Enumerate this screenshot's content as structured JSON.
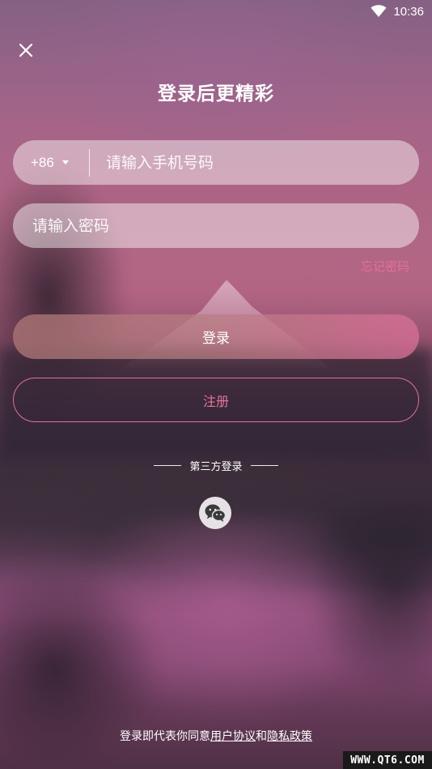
{
  "status_bar": {
    "time": "10:36",
    "icons": [
      "wifi-icon"
    ]
  },
  "header": {
    "close_icon": "close-icon",
    "title": "登录后更精彩"
  },
  "form": {
    "country_code": "+86",
    "phone_placeholder": "请输入手机号码",
    "password_placeholder": "请输入密码",
    "forgot_password": "忘记密码",
    "login_label": "登录",
    "register_label": "注册"
  },
  "third_party": {
    "label": "第三方登录",
    "providers": [
      "wechat-icon"
    ]
  },
  "agreement": {
    "prefix": "登录即代表你同意",
    "user_agreement": "用户协议",
    "conjunction": "和",
    "privacy_policy": "隐私政策"
  },
  "watermark": "WWW.QT6.COM",
  "colors": {
    "accent_pink": "#e2709a",
    "field_bg": "rgba(255,255,255,0.45)"
  }
}
